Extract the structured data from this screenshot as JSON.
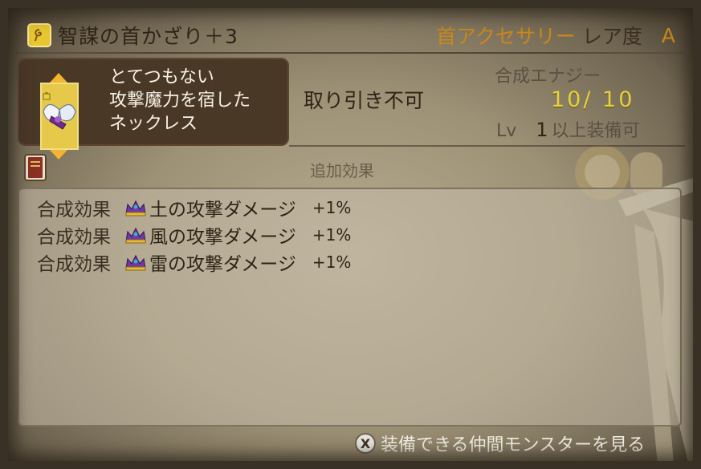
{
  "header": {
    "item_name": "智謀の首かざり＋3",
    "category": "首アクセサリー",
    "rarity_label": "レア度",
    "rarity_grade": "A"
  },
  "item": {
    "description_lines": [
      "とてつもない",
      "攻撃魔力を宿した",
      "ネックレス"
    ],
    "icon": "winged-necklace-icon"
  },
  "trade_status": "取り引き不可",
  "synthesis": {
    "energy_label": "合成エナジー",
    "energy_value": "10/ 10"
  },
  "level_requirement": {
    "prefix": "Lv",
    "level": "1",
    "suffix": "以上装備可"
  },
  "effects": {
    "heading": "追加効果",
    "rows": [
      {
        "type": "合成効果",
        "name": "土の攻撃ダメージ",
        "value": "+1%",
        "icon": "crown-gem-icon"
      },
      {
        "type": "合成効果",
        "name": "風の攻撃ダメージ",
        "value": "+1%",
        "icon": "crown-gem-icon"
      },
      {
        "type": "合成効果",
        "name": "雷の攻撃ダメージ",
        "value": "+1%",
        "icon": "crown-gem-icon"
      }
    ]
  },
  "footer": {
    "button_glyph": "X",
    "action_label": "装備できる仲間モンスターを見る"
  },
  "colors": {
    "accent_orange": "#c9881a",
    "energy_yellow": "#e8d23a",
    "panel_brown": "#4a3826"
  }
}
